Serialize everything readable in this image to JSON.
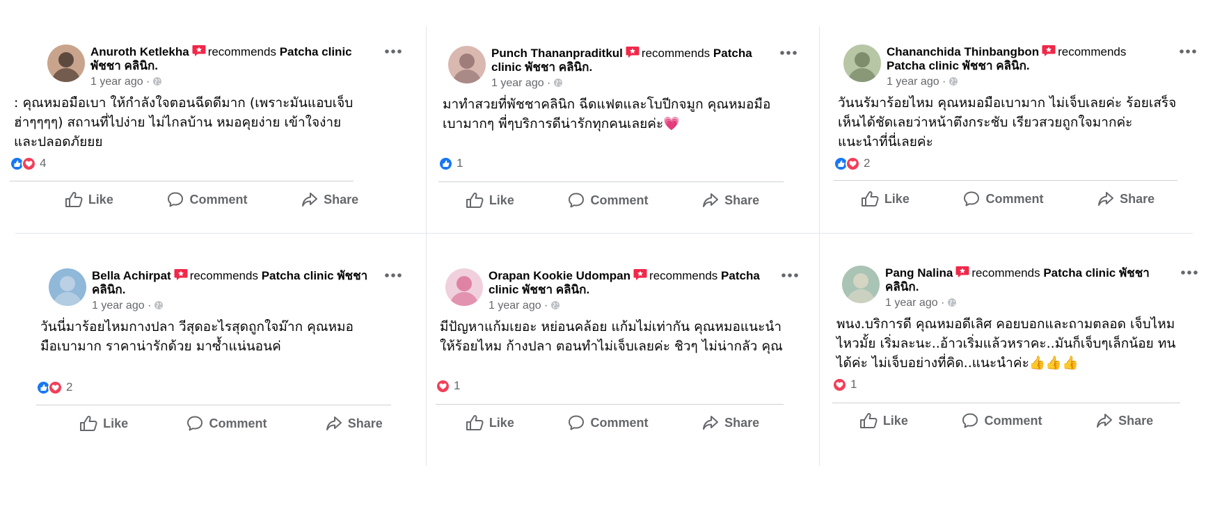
{
  "reviews": [
    {
      "author": "Anuroth Ketlekha",
      "recommends": "recommends",
      "page_line1": "Patcha clinic",
      "page_line2": "พัชชา คลินิก.",
      "time": "1 year ago ·",
      "text": ": คุณหมอมือเบา ให้กำลังใจตอนฉีดดีมาก (เพราะมันแอบเจ็บ\nฮ่าๆๆๆๆ) สถานที่ไปง่าย ไม่ไกลบ้าน หมอคุยง่าย เข้าใจง่าย\nและปลอดภัยยย",
      "reaction_count": "4",
      "reactions": [
        "like",
        "love"
      ]
    },
    {
      "author": "Punch Thananpraditkul",
      "recommends": "recommends",
      "page_line1": "Patcha",
      "page_line2": "clinic พัชชา คลินิก.",
      "time": "1 year ago ·",
      "text": "มาทำสวยที่พัชชาคลินิก ฉีดแฟตและโบปีกจมูก คุณหมอมือ\nเบามากๆ พี่ๆบริการดีน่ารักทุกคนเลยค่ะ💗",
      "reaction_count": "1",
      "reactions": [
        "like"
      ]
    },
    {
      "author": "Chananchida Thinbangbon",
      "recommends": "recommends",
      "page_line1": "",
      "page_line2": "Patcha clinic พัชชา คลินิก.",
      "time": "1 year ago ·",
      "text": "วันนรัมาร้อยไหม คุณหมอมือเบามาก ไม่เจ็บเลยค่ะ ร้อยเสร็จ\nเห็นได้ชัดเลยว่าหน้าตึงกระชับ เรียวสวยถูกใจมากค่ะ\nแนะนำที่นี่เลยค่ะ",
      "reaction_count": "2",
      "reactions": [
        "like",
        "love"
      ]
    },
    {
      "author": "Bella Achirpat",
      "recommends": "recommends",
      "page_line1": "Patcha clinic พัชชา",
      "page_line2": "คลินิก.",
      "time": "1 year ago ·",
      "text": "วันนี่มาร้อยไหมกางปลา วีสุดอะไรสุดถูกใจม๊าก คุณหมอ\nมือเบามาก ราคาน่ารักด้วย มาซ้ำแน่นอนค่",
      "reaction_count": "2",
      "reactions": [
        "like",
        "love"
      ]
    },
    {
      "author": "Orapan Kookie Udompan",
      "recommends": "recommends",
      "page_line1": "Patcha",
      "page_line2": "clinic พัชชา คลินิก.",
      "time": "1 year ago ·",
      "text": "มีปัญหาแก้มเยอะ หย่อนคล้อย แก้มไม่เท่ากัน คุณหมอแนะนำ\nให้ร้อยไหม ก้างปลา ตอนทำไม่เจ็บเลยค่ะ ชิวๆ ไม่น่ากลัว คุณ",
      "reaction_count": "1",
      "reactions": [
        "love"
      ]
    },
    {
      "author": "Pang Nalina",
      "recommends": "recommends",
      "page_line1": "Patcha clinic พัชชา",
      "page_line2": "คลินิก.",
      "time": "1 year ago ·",
      "text": "พนง.บริการดี คุณหมอดีเลิศ  คอยบอกและถามตลอด เจ็บไหม\nไหวมั้ย เริ่มละนะ..อ้าวเริ่มแล้วหราคะ..มันก็เจ็บๆเล็กน้อย ทน\nได้ค่ะ ไม่เจ็บอย่างที่คิด..แนะนำค่ะ👍👍👍",
      "reaction_count": "1",
      "reactions": [
        "love"
      ]
    }
  ],
  "actions": {
    "like": "Like",
    "comment": "Comment",
    "share": "Share"
  },
  "colors": {
    "like_blue": "#1877f2",
    "love_red": "#f33e58",
    "recommend_red": "#f02849",
    "secondary_text": "#65676b",
    "divider": "#ced0d4"
  },
  "icons": {
    "recommend": "recommend-badge-icon",
    "globe": "globe-icon",
    "more": "more-options-icon",
    "like": "thumbs-up-icon",
    "comment": "comment-bubble-icon",
    "share": "share-arrow-icon"
  }
}
